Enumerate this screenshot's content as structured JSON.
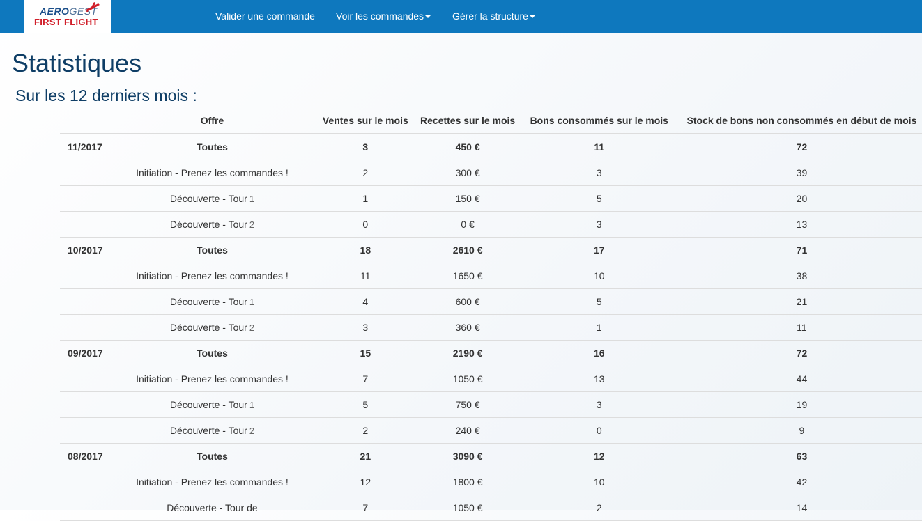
{
  "navbar": {
    "logo": {
      "line1_a": "AERO",
      "line1_b": "GEST",
      "line2": "FIRST FLIGHT"
    },
    "items": [
      {
        "label": "Valider une commande",
        "dropdown": false
      },
      {
        "label": "Voir les commandes",
        "dropdown": true
      },
      {
        "label": "Gérer la structure",
        "dropdown": true
      }
    ]
  },
  "page": {
    "title": "Statistiques",
    "subtitle": "Sur les 12 derniers mois :"
  },
  "table": {
    "headers": [
      "",
      "Offre",
      "Ventes sur le mois",
      "Recettes sur le mois",
      "Bons consommés sur le mois",
      "Stock de bons non consommés en début de mois"
    ],
    "months": [
      {
        "month": "11/2017",
        "rows": [
          {
            "offre": "Toutes",
            "num": "",
            "ventes": "3",
            "recettes": "450 €",
            "bons": "11",
            "stock": "72"
          },
          {
            "offre": "Initiation - Prenez les commandes !",
            "num": "",
            "ventes": "2",
            "recettes": "300 €",
            "bons": "3",
            "stock": "39"
          },
          {
            "offre": "Découverte - Tour",
            "num": "1",
            "ventes": "1",
            "recettes": "150 €",
            "bons": "5",
            "stock": "20"
          },
          {
            "offre": "Découverte - Tour",
            "num": "2",
            "ventes": "0",
            "recettes": "0 €",
            "bons": "3",
            "stock": "13"
          }
        ]
      },
      {
        "month": "10/2017",
        "rows": [
          {
            "offre": "Toutes",
            "num": "",
            "ventes": "18",
            "recettes": "2610 €",
            "bons": "17",
            "stock": "71"
          },
          {
            "offre": "Initiation - Prenez les commandes !",
            "num": "",
            "ventes": "11",
            "recettes": "1650 €",
            "bons": "10",
            "stock": "38"
          },
          {
            "offre": "Découverte - Tour",
            "num": "1",
            "ventes": "4",
            "recettes": "600 €",
            "bons": "5",
            "stock": "21"
          },
          {
            "offre": "Découverte - Tour",
            "num": "2",
            "ventes": "3",
            "recettes": "360 €",
            "bons": "1",
            "stock": "11"
          }
        ]
      },
      {
        "month": "09/2017",
        "rows": [
          {
            "offre": "Toutes",
            "num": "",
            "ventes": "15",
            "recettes": "2190 €",
            "bons": "16",
            "stock": "72"
          },
          {
            "offre": "Initiation - Prenez les commandes !",
            "num": "",
            "ventes": "7",
            "recettes": "1050 €",
            "bons": "13",
            "stock": "44"
          },
          {
            "offre": "Découverte - Tour",
            "num": "1",
            "ventes": "5",
            "recettes": "750 €",
            "bons": "3",
            "stock": "19"
          },
          {
            "offre": "Découverte - Tour",
            "num": "2",
            "ventes": "2",
            "recettes": "240 €",
            "bons": "0",
            "stock": "9"
          }
        ]
      },
      {
        "month": "08/2017",
        "rows": [
          {
            "offre": "Toutes",
            "num": "",
            "ventes": "21",
            "recettes": "3090 €",
            "bons": "12",
            "stock": "63"
          },
          {
            "offre": "Initiation - Prenez les commandes !",
            "num": "",
            "ventes": "12",
            "recettes": "1800 €",
            "bons": "10",
            "stock": "42"
          },
          {
            "offre": "Découverte - Tour de",
            "num": "",
            "ventes": "7",
            "recettes": "1050 €",
            "bons": "2",
            "stock": "14"
          }
        ]
      }
    ]
  }
}
